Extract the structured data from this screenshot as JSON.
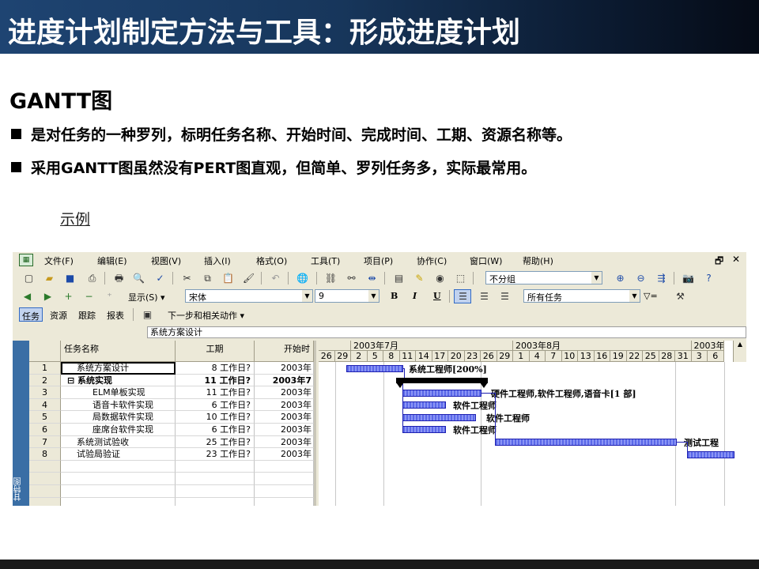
{
  "slide": {
    "title": "进度计划制定方法与工具：形成进度计划",
    "heading": "GANTT图",
    "bullets": [
      "是对任务的一种罗列，标明任务名称、开始时间、完成时间、工期、资源名称等。",
      "采用GANTT图虽然没有PERT图直观，但简单、罗列任务多，实际最常用。"
    ],
    "example_label": "示例"
  },
  "project": {
    "menu": [
      "文件(F)",
      "编辑(E)",
      "视图(V)",
      "插入(I)",
      "格式(O)",
      "工具(T)",
      "项目(P)",
      "协作(C)",
      "窗口(W)",
      "帮助(H)"
    ],
    "window_controls": [
      "restore-icon",
      "close-icon"
    ],
    "toolbar1": {
      "icons": [
        "new-icon",
        "open-icon",
        "save-icon",
        "print-preview-icon",
        "print-icon",
        "preview-icon",
        "spell-icon",
        "cut-icon",
        "copy-icon",
        "paste-icon",
        "format-painter-icon",
        "undo-icon",
        "web-icon",
        "link-icon",
        "unlink-icon",
        "split-icon",
        "task-info-icon",
        "notes-icon",
        "assign-icon",
        "publish-icon"
      ],
      "group_combo": "不分组",
      "icons_right": [
        "zoom-in-icon",
        "zoom-out-icon",
        "scroll-to-task-icon",
        "copy-picture-icon",
        "help-icon"
      ]
    },
    "toolbar2": {
      "show_label": "显示(S) ▾",
      "font": "宋体",
      "size": "9",
      "bold": "B",
      "italic": "I",
      "underline": "U",
      "filter": "所有任务",
      "filter_icon_label": "▽="
    },
    "toolbar3": {
      "tabs": [
        "任务",
        "资源",
        "跟踪",
        "报表"
      ],
      "next_step": "下一步和相关动作 ▾"
    },
    "entry_value": "系统方案设计",
    "view_bar_label": "甘特图",
    "columns": [
      "任务名称",
      "工期",
      "开始时"
    ],
    "tasks": [
      {
        "id": "1",
        "name": "系统方案设计",
        "duration": "8 工作日?",
        "start": "2003年",
        "indent": 1,
        "summary": false
      },
      {
        "id": "2",
        "name": "⊟ 系统实现",
        "duration": "11 工作日?",
        "start": "2003年7",
        "indent": 0,
        "summary": true
      },
      {
        "id": "3",
        "name": "ELM单板实现",
        "duration": "11 工作日?",
        "start": "2003年",
        "indent": 2,
        "summary": false
      },
      {
        "id": "4",
        "name": "语音卡软件实现",
        "duration": "6 工作日?",
        "start": "2003年",
        "indent": 2,
        "summary": false
      },
      {
        "id": "5",
        "name": "局数据软件实现",
        "duration": "10 工作日?",
        "start": "2003年",
        "indent": 2,
        "summary": false
      },
      {
        "id": "6",
        "name": "座席台软件实现",
        "duration": "6 工作日?",
        "start": "2003年",
        "indent": 2,
        "summary": false
      },
      {
        "id": "7",
        "name": "系统测试验收",
        "duration": "25 工作日?",
        "start": "2003年",
        "indent": 1,
        "summary": false
      },
      {
        "id": "8",
        "name": "试验局验证",
        "duration": "23 工作日?",
        "start": "2003年",
        "indent": 1,
        "summary": false
      }
    ],
    "timescale": {
      "weeks": [
        "",
        "2003年7月",
        "",
        "",
        "",
        "",
        "",
        "2003年8月",
        "",
        "",
        "",
        "",
        "",
        "2003年9"
      ],
      "days": [
        "26",
        "29",
        "2",
        "5",
        "8",
        "11",
        "14",
        "17",
        "20",
        "23",
        "26",
        "29",
        "1",
        "4",
        "7",
        "10",
        "13",
        "16",
        "19",
        "22",
        "25",
        "28",
        "31",
        "3",
        "6"
      ]
    },
    "resources": [
      "系统工程师[200%]",
      "硬件工程师,软件工程师,语音卡[1 部]",
      "软件工程师",
      "软件工程师",
      "软件工程师",
      "测试工程"
    ]
  }
}
